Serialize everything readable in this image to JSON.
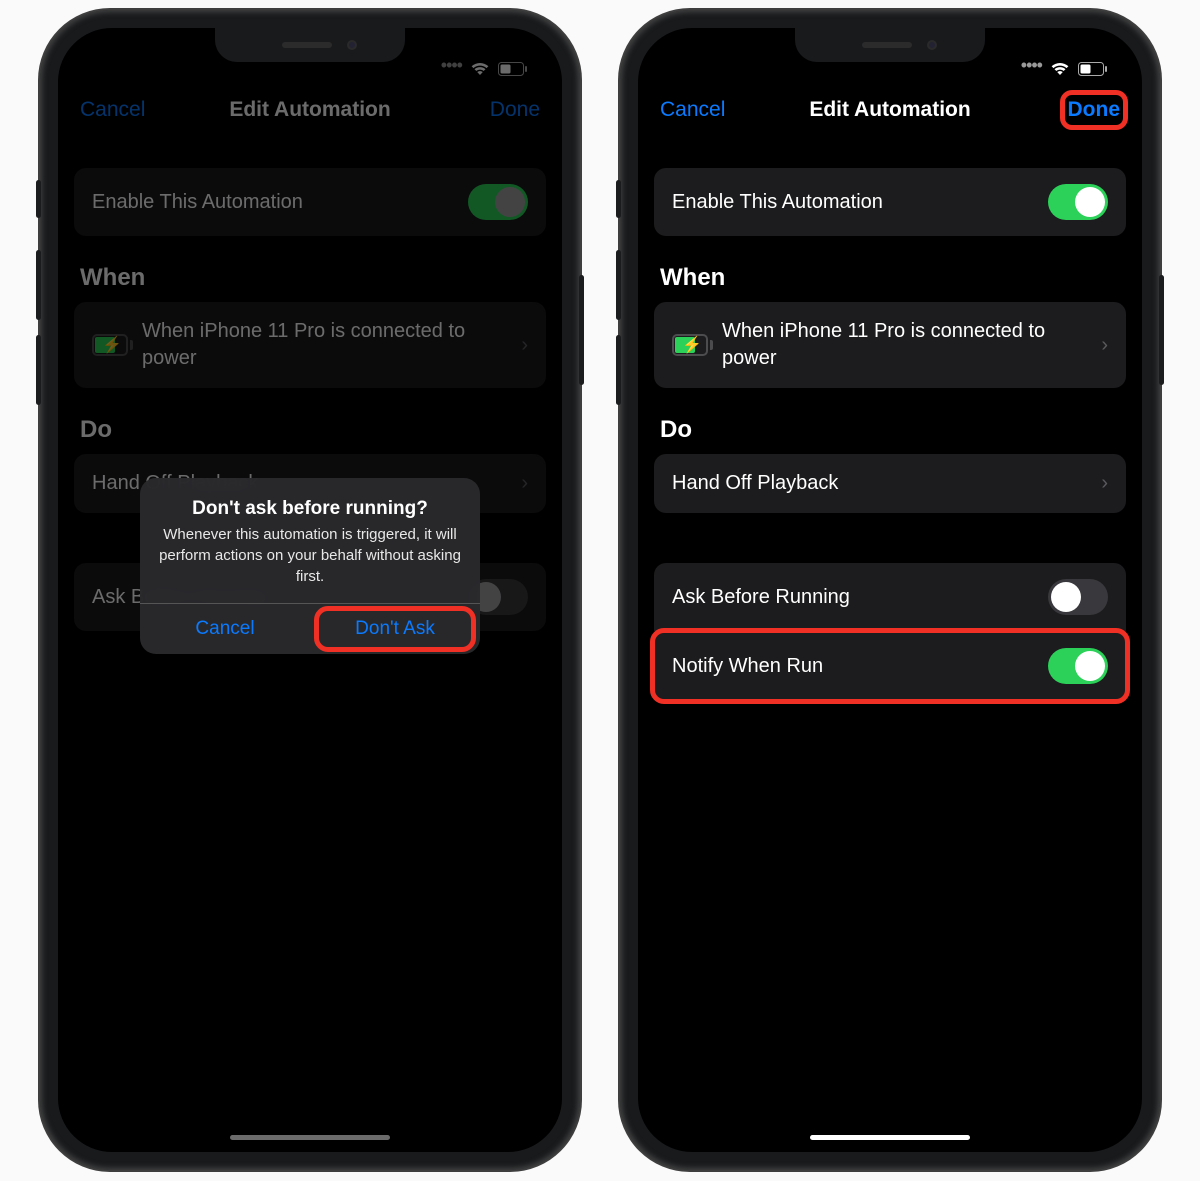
{
  "nav": {
    "cancel": "Cancel",
    "title": "Edit Automation",
    "done": "Done"
  },
  "enable": {
    "label": "Enable This Automation"
  },
  "when": {
    "header": "When",
    "trigger": "When iPhone 11 Pro is connected to power"
  },
  "do": {
    "header": "Do",
    "action": "Hand Off Playback"
  },
  "rows": {
    "ask": "Ask Before Running",
    "notify": "Notify When Run"
  },
  "alert": {
    "title": "Don't ask before running?",
    "message": "Whenever this automation is triggered, it will perform actions on your behalf without asking first.",
    "cancel": "Cancel",
    "confirm": "Don't Ask"
  }
}
